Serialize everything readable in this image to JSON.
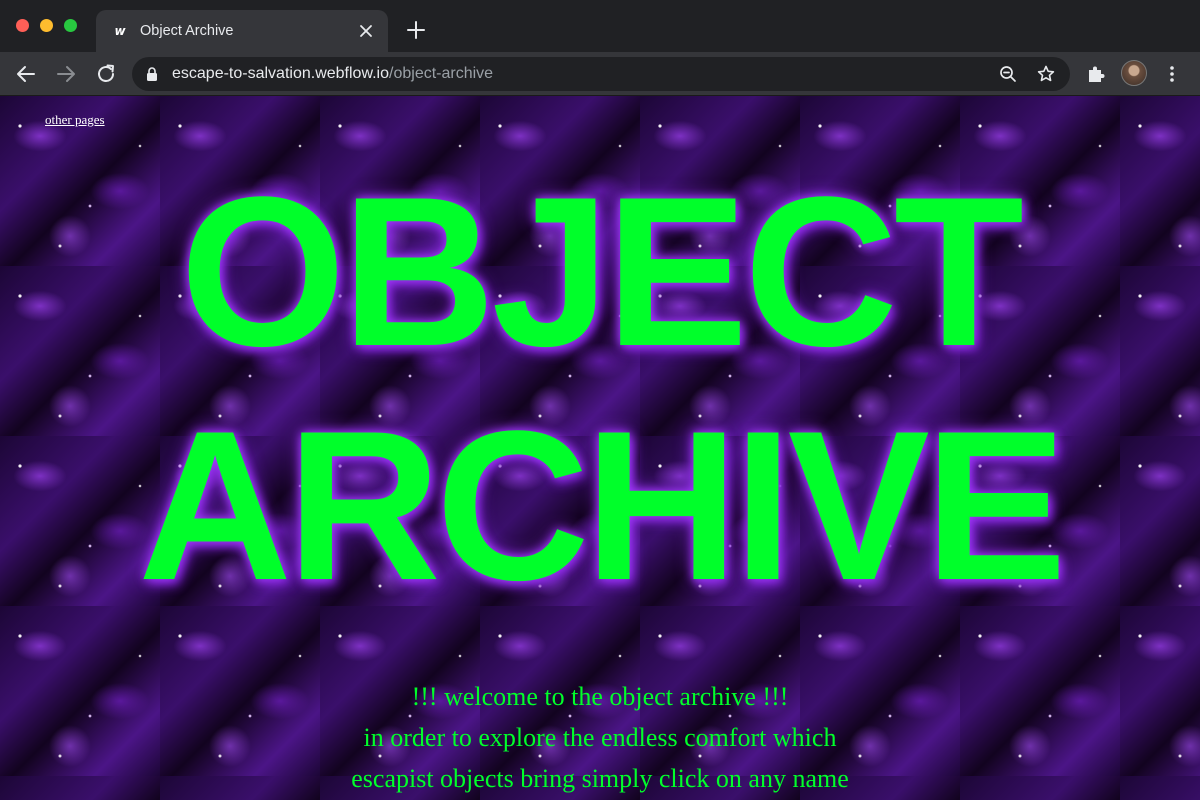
{
  "browser": {
    "tab": {
      "title": "Object Archive",
      "favicon": "w"
    },
    "url": {
      "host": "escape-to-salvation.webflow.io",
      "path": "/object-archive"
    },
    "icons": {
      "back": "arrow-left-icon",
      "forward": "arrow-right-icon",
      "reload": "reload-icon",
      "lock": "lock-icon",
      "zoom": "zoom-out-icon",
      "bookmark": "star-icon",
      "extensions": "puzzle-icon",
      "profile": "avatar",
      "menu": "kebab-menu-icon",
      "close_tab": "close-icon",
      "new_tab": "plus-icon"
    }
  },
  "page": {
    "nav_link": "other pages",
    "headline": {
      "line1": "OBJECT",
      "line2": "ARCHIVE"
    },
    "welcome": [
      "!!! welcome to the object archive !!!",
      "in order to explore the endless comfort which",
      "escapist objects bring simply click on any name"
    ]
  },
  "colors": {
    "headline": "#00ff2a",
    "glow": "#a63bff",
    "chrome_dark": "#202124",
    "chrome_tab": "#35363a"
  }
}
